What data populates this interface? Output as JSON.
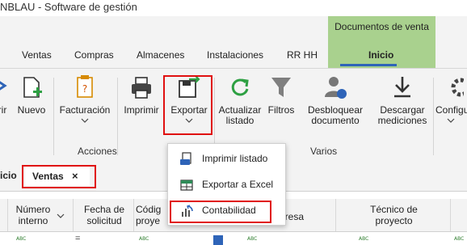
{
  "window": {
    "title": "NBLAU - Software de gestión"
  },
  "context_tab": {
    "group_title": "Documentos de venta",
    "tab_label": "Inicio",
    "color": "#a9d18e",
    "underline_color": "#2e64b8"
  },
  "ribbon_tabs": [
    "Ventas",
    "Compras",
    "Almacenes",
    "Instalaciones",
    "RR HH"
  ],
  "ribbon": {
    "first_partial_label": "rir",
    "nuevo": "Nuevo",
    "facturacion": "Facturación",
    "imprimir": "Imprimir",
    "exportar": "Exportar",
    "actualizar_1": "Actualizar",
    "actualizar_2": "listado",
    "filtros": "Filtros",
    "desbloquear_1": "Desbloquear",
    "desbloquear_2": "documento",
    "descargar_1": "Descargar",
    "descargar_2": "mediciones",
    "configurar": "Configu",
    "group_acciones": "Acciones",
    "group_varios": "Varios"
  },
  "export_menu": {
    "items": [
      {
        "label": "Imprimir listado",
        "icon": "print-list-icon"
      },
      {
        "label": "Exportar a Excel",
        "icon": "excel-icon"
      },
      {
        "label": "Contabilidad",
        "icon": "accounting-icon"
      }
    ]
  },
  "doc_tabs": {
    "inicio_partial": "icio",
    "ventas": "Ventas",
    "close_glyph": "×"
  },
  "grid": {
    "columns": [
      {
        "line1": "Número",
        "line2": "interno"
      },
      {
        "line1": "Fecha de",
        "line2": "solicitud"
      },
      {
        "line1": "Códig",
        "line2": "proye"
      },
      {
        "line1": "mpresa",
        "line2": ""
      },
      {
        "line1": "Técnico de",
        "line2": "proyecto"
      }
    ],
    "cell_glyph": "ABC",
    "equals_glyph": "="
  },
  "highlight_color": "#e01010"
}
